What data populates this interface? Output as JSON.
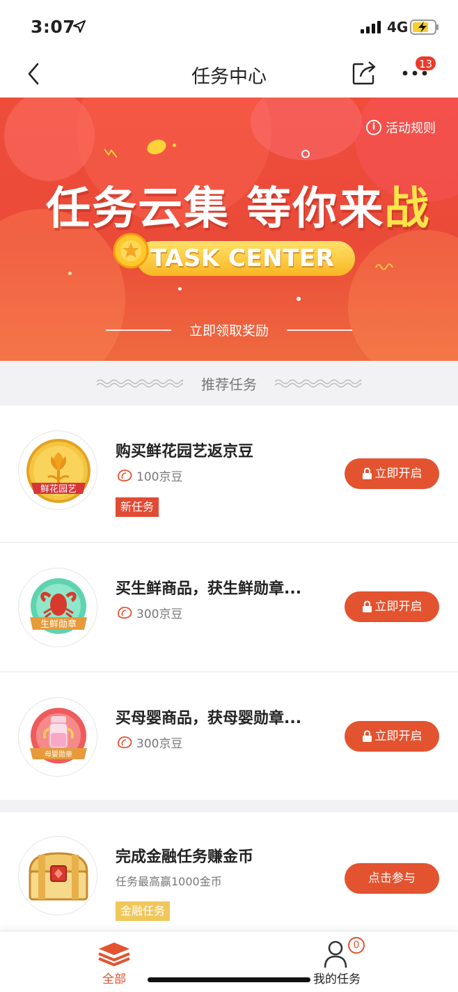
{
  "status_bar": {
    "time": "3:07",
    "network": "4G"
  },
  "nav": {
    "title": "任务中心",
    "badge": "13"
  },
  "banner": {
    "rules": "活动规则",
    "headline_main": "任务云集 等你来",
    "headline_accent": "战",
    "pill": "TASK CENTER",
    "claim": "立即领取奖励"
  },
  "section": {
    "title": "推荐任务"
  },
  "tasks": [
    {
      "title": "购买鲜花园艺返京豆",
      "reward": "100京豆",
      "tag": "新任务",
      "badge_label": "鲜花园艺",
      "button": "立即开启"
    },
    {
      "title": "买生鲜商品，获生鲜勋章...",
      "reward": "300京豆",
      "badge_label": "生鲜勋章",
      "button": "立即开启"
    },
    {
      "title": "买母婴商品，获母婴勋章...",
      "reward": "300京豆",
      "badge_label": "母婴勋章",
      "button": "立即开启"
    },
    {
      "title": "完成金融任务赚金币",
      "reward": "任务最高赢1000金币",
      "tag": "金融任务",
      "button": "点击参与"
    }
  ],
  "tabs": {
    "all": "全部",
    "mine": "我的任务",
    "mine_badge": "0"
  },
  "colors": {
    "accent": "#e3532f",
    "banner": "#ea4a38",
    "gold": "#f8b622"
  }
}
